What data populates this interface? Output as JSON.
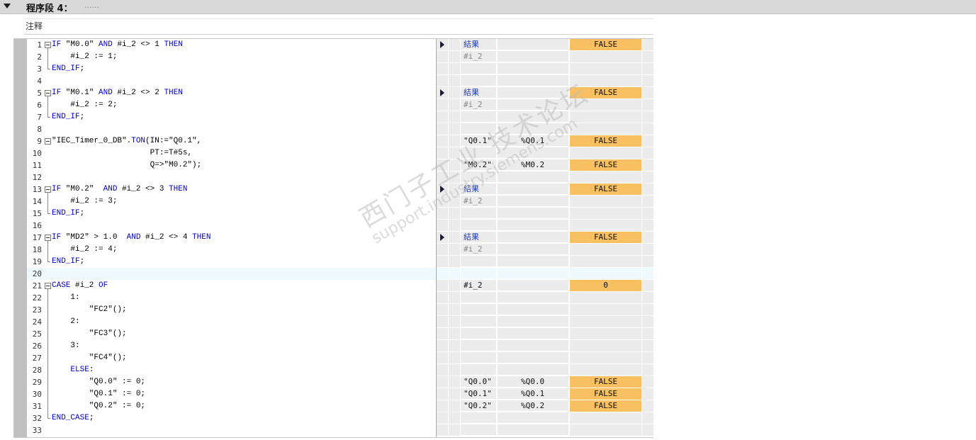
{
  "network": {
    "title": "程序段 4：",
    "title_dots": "......",
    "comment_label": "注释"
  },
  "code_lines": [
    "IF \"M0.0\" AND #i_2 <> 1 THEN",
    "    #i_2 := 1;",
    "END_IF;",
    "",
    "IF \"M0.1\" AND #i_2 <> 2 THEN",
    "    #i_2 := 2;",
    "END_IF;",
    "",
    "\"IEC_Timer_0_DB\".TON(IN:=\"Q0.1\",",
    "                     PT:=T#5s,",
    "                     Q=>\"M0.2\");",
    "",
    "IF \"M0.2\"  AND #i_2 <> 3 THEN",
    "    #i_2 := 3;",
    "END_IF;",
    "",
    "IF \"MD2\" > 1.0  AND #i_2 <> 4 THEN",
    "    #i_2 := 4;",
    "END_IF;",
    "",
    "CASE #i_2 OF",
    "    1:",
    "        \"FC2\"();",
    "    2:",
    "        \"FC3\"();",
    "    3:",
    "        \"FC4\"();",
    "    ELSE:",
    "        \"Q0.0\" := 0;",
    "        \"Q0.1\" := 0;",
    "        \"Q0.2\" := 0;",
    "END_CASE;",
    ""
  ],
  "watch_rows": {
    "1": {
      "arrow": true,
      "name": "結果",
      "addr": "",
      "value": "FALSE"
    },
    "2": {
      "name": "#i_2",
      "gray": true
    },
    "5": {
      "arrow": true,
      "name": "結果",
      "addr": "",
      "value": "FALSE"
    },
    "6": {
      "name": "#i_2",
      "gray": true
    },
    "9": {
      "name": "\"Q0.1\"",
      "addr": "%Q0.1",
      "value": "FALSE"
    },
    "11": {
      "name": "\"M0.2\"",
      "addr": "%M0.2",
      "value": "FALSE"
    },
    "13": {
      "arrow": true,
      "name": "結果",
      "addr": "",
      "value": "FALSE"
    },
    "14": {
      "name": "#i_2",
      "gray": true
    },
    "17": {
      "arrow": true,
      "name": "結果",
      "addr": "",
      "value": "FALSE"
    },
    "18": {
      "name": "#i_2",
      "gray": true
    },
    "21": {
      "name": "#i_2",
      "addr": "",
      "value": "0"
    },
    "29": {
      "name": "\"Q0.0\"",
      "addr": "%Q0.0",
      "value": "FALSE"
    },
    "30": {
      "name": "\"Q0.1\"",
      "addr": "%Q0.1",
      "value": "FALSE"
    },
    "31": {
      "name": "\"Q0.2\"",
      "addr": "%Q0.2",
      "value": "FALSE"
    }
  },
  "watermark": {
    "line1": "西门子工业  技术论坛",
    "line2": "support.industry.siemens.com"
  },
  "colors": {
    "keyword": "#0000c8",
    "value_highlight": "#f8c060",
    "result_label": "#1a3cc8"
  }
}
